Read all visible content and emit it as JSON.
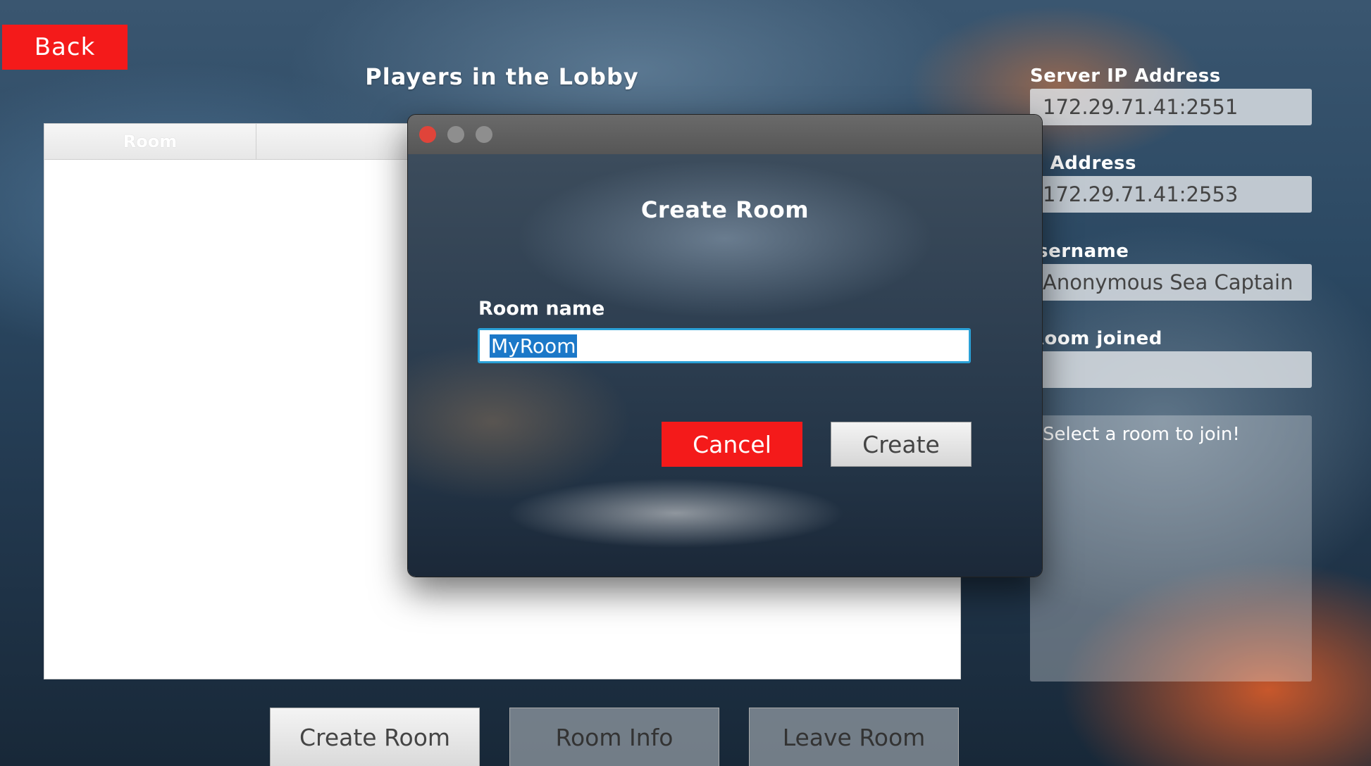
{
  "back_button": "Back",
  "lobby_title": "Players in the Lobby",
  "room_table": {
    "columns": [
      "Room",
      ""
    ]
  },
  "fields": {
    "server_ip": {
      "label": "Server IP Address",
      "value": "172.29.71.41:2551"
    },
    "my_ip": {
      "label": "p Address",
      "value": "172.29.71.41:2553"
    },
    "username": {
      "label": "Jsername",
      "value": "Anonymous Sea Captain"
    },
    "room_joined": {
      "label": "Room joined",
      "value": ""
    }
  },
  "status_message": "Select a room to join!",
  "bottom_buttons": {
    "create": "Create Room",
    "info": "Room Info",
    "leave": "Leave Room"
  },
  "dialog": {
    "title": "Create Room",
    "room_name_label": "Room name",
    "room_name_value": "MyRoom",
    "cancel": "Cancel",
    "create": "Create"
  },
  "colors": {
    "accent_red": "#f41a1a",
    "focus_blue": "#2aa0d6",
    "selection_blue": "#1b78c8"
  }
}
